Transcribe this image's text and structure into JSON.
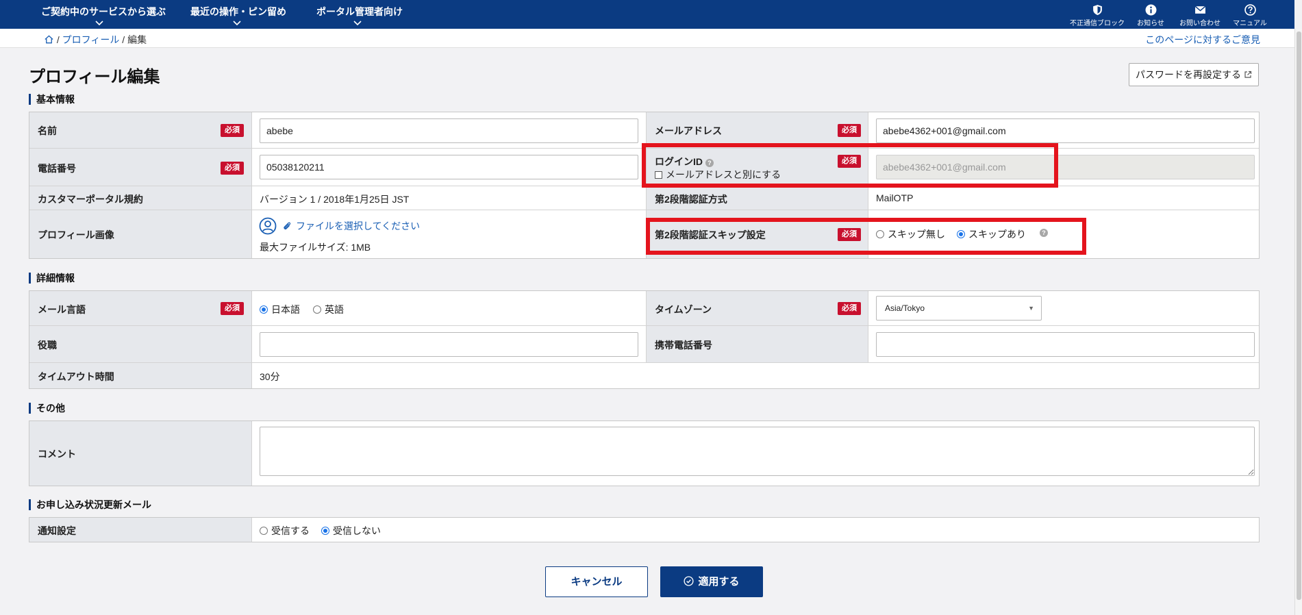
{
  "nav": {
    "menus": [
      "ご契約中のサービスから選ぶ",
      "最近の操作・ピン留め",
      "ポータル管理者向け"
    ],
    "icons": [
      {
        "name": "shield-icon",
        "label": "不正通信ブロック"
      },
      {
        "name": "info-icon",
        "label": "お知らせ"
      },
      {
        "name": "mail-icon",
        "label": "お問い合わせ"
      },
      {
        "name": "question-icon",
        "label": "マニュアル"
      }
    ]
  },
  "breadcrumb": {
    "profile": "プロフィール",
    "current": "編集",
    "sep": "/"
  },
  "feedback_link": "このページに対するご意見",
  "page_title": "プロフィール編集",
  "reset_password_button": "パスワードを再設定する",
  "required_badge": "必須",
  "sections": {
    "basic": "基本情報",
    "detail": "詳細情報",
    "other": "その他",
    "mail": "お申し込み状況更新メール"
  },
  "basic": {
    "name_label": "名前",
    "name_value": "abebe",
    "email_label": "メールアドレス",
    "email_value": "abebe4362+001@gmail.com",
    "phone_label": "電話番号",
    "phone_value": "05038120211",
    "loginid_label": "ログインID",
    "loginid_checkbox": "メールアドレスと別にする",
    "loginid_value": "abebe4362+001@gmail.com",
    "terms_label": "カスタマーポータル規約",
    "terms_value": "バージョン 1 / 2018年1月25日 JST",
    "twofa_label": "第2段階認証方式",
    "twofa_value": "MailOTP",
    "image_label": "プロフィール画像",
    "image_select": "ファイルを選択してください",
    "image_maxsize": "最大ファイルサイズ: 1MB",
    "skip_label": "第2段階認証スキップ設定",
    "skip_options": [
      "スキップ無し",
      "スキップあり"
    ],
    "skip_selected": "スキップあり"
  },
  "detail": {
    "mail_lang_label": "メール言語",
    "mail_lang_options": [
      "日本語",
      "英語"
    ],
    "mail_lang_selected": "日本語",
    "timezone_label": "タイムゾーン",
    "timezone_value": "Asia/Tokyo",
    "position_label": "役職",
    "position_value": "",
    "mobile_label": "携帯電話番号",
    "mobile_value": "",
    "timeout_label": "タイムアウト時間",
    "timeout_value": "30分"
  },
  "other": {
    "comment_label": "コメント",
    "comment_value": ""
  },
  "mail": {
    "notify_label": "通知設定",
    "notify_options": [
      "受信する",
      "受信しない"
    ],
    "notify_selected": "受信しない"
  },
  "buttons": {
    "cancel": "キャンセル",
    "apply": "適用する"
  },
  "colors": {
    "brand": "#0b3b82",
    "required": "#c8102e",
    "highlight": "#e4141d",
    "link": "#1a5fb4"
  }
}
